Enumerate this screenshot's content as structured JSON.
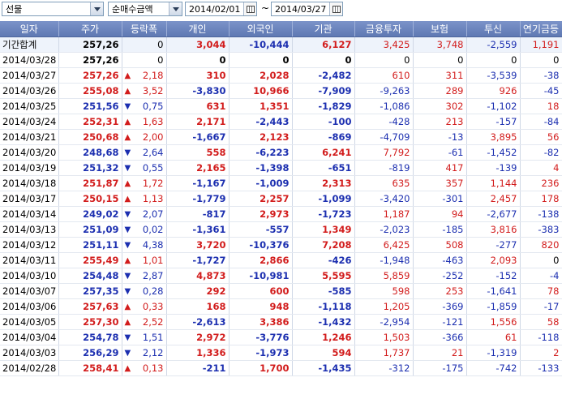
{
  "toolbar": {
    "market_select": "선물",
    "metric_select": "순매수금액",
    "date_from": "2014/02/01",
    "date_sep": "~",
    "date_to": "2014/03/27"
  },
  "columns": [
    "일자",
    "주가",
    "등락폭",
    "개인",
    "외국인",
    "기관",
    "금융투자",
    "보험",
    "투신",
    "연기금등"
  ],
  "rows": [
    {
      "date": "기간합계",
      "price": "257,26",
      "dir": "",
      "chg": "0",
      "ind": "3,044",
      "frgn": "-10,444",
      "inst": "6,127",
      "fin": "3,425",
      "ins": "3,748",
      "trust": "-2,559",
      "pens": "1,191"
    },
    {
      "date": "2014/03/28",
      "price": "257,26",
      "dir": "",
      "chg": "0",
      "ind": "0",
      "frgn": "0",
      "inst": "0",
      "fin": "0",
      "ins": "0",
      "trust": "0",
      "pens": "0"
    },
    {
      "date": "2014/03/27",
      "price": "257,26",
      "dir": "up",
      "chg": "2,18",
      "ind": "310",
      "frgn": "2,028",
      "inst": "-2,482",
      "fin": "610",
      "ins": "311",
      "trust": "-3,539",
      "pens": "-38"
    },
    {
      "date": "2014/03/26",
      "price": "255,08",
      "dir": "up",
      "chg": "3,52",
      "ind": "-3,830",
      "frgn": "10,966",
      "inst": "-7,909",
      "fin": "-9,263",
      "ins": "289",
      "trust": "926",
      "pens": "-45"
    },
    {
      "date": "2014/03/25",
      "price": "251,56",
      "dir": "down",
      "chg": "0,75",
      "ind": "631",
      "frgn": "1,351",
      "inst": "-1,829",
      "fin": "-1,086",
      "ins": "302",
      "trust": "-1,102",
      "pens": "18"
    },
    {
      "date": "2014/03/24",
      "price": "252,31",
      "dir": "up",
      "chg": "1,63",
      "ind": "2,171",
      "frgn": "-2,443",
      "inst": "-100",
      "fin": "-428",
      "ins": "213",
      "trust": "-157",
      "pens": "-84"
    },
    {
      "date": "2014/03/21",
      "price": "250,68",
      "dir": "up",
      "chg": "2,00",
      "ind": "-1,667",
      "frgn": "2,123",
      "inst": "-869",
      "fin": "-4,709",
      "ins": "-13",
      "trust": "3,895",
      "pens": "56"
    },
    {
      "date": "2014/03/20",
      "price": "248,68",
      "dir": "down",
      "chg": "2,64",
      "ind": "558",
      "frgn": "-6,223",
      "inst": "6,241",
      "fin": "7,792",
      "ins": "-61",
      "trust": "-1,452",
      "pens": "-82"
    },
    {
      "date": "2014/03/19",
      "price": "251,32",
      "dir": "down",
      "chg": "0,55",
      "ind": "2,165",
      "frgn": "-1,398",
      "inst": "-651",
      "fin": "-819",
      "ins": "417",
      "trust": "-139",
      "pens": "4"
    },
    {
      "date": "2014/03/18",
      "price": "251,87",
      "dir": "up",
      "chg": "1,72",
      "ind": "-1,167",
      "frgn": "-1,009",
      "inst": "2,313",
      "fin": "635",
      "ins": "357",
      "trust": "1,144",
      "pens": "236"
    },
    {
      "date": "2014/03/17",
      "price": "250,15",
      "dir": "up",
      "chg": "1,13",
      "ind": "-1,779",
      "frgn": "2,257",
      "inst": "-1,099",
      "fin": "-3,420",
      "ins": "-301",
      "trust": "2,457",
      "pens": "178"
    },
    {
      "date": "2014/03/14",
      "price": "249,02",
      "dir": "down",
      "chg": "2,07",
      "ind": "-817",
      "frgn": "2,973",
      "inst": "-1,723",
      "fin": "1,187",
      "ins": "94",
      "trust": "-2,677",
      "pens": "-138"
    },
    {
      "date": "2014/03/13",
      "price": "251,09",
      "dir": "down",
      "chg": "0,02",
      "ind": "-1,361",
      "frgn": "-557",
      "inst": "1,349",
      "fin": "-2,023",
      "ins": "-185",
      "trust": "3,816",
      "pens": "-383"
    },
    {
      "date": "2014/03/12",
      "price": "251,11",
      "dir": "down",
      "chg": "4,38",
      "ind": "3,720",
      "frgn": "-10,376",
      "inst": "7,208",
      "fin": "6,425",
      "ins": "508",
      "trust": "-277",
      "pens": "820"
    },
    {
      "date": "2014/03/11",
      "price": "255,49",
      "dir": "up",
      "chg": "1,01",
      "ind": "-1,727",
      "frgn": "2,866",
      "inst": "-426",
      "fin": "-1,948",
      "ins": "-463",
      "trust": "2,093",
      "pens": "0"
    },
    {
      "date": "2014/03/10",
      "price": "254,48",
      "dir": "down",
      "chg": "2,87",
      "ind": "4,873",
      "frgn": "-10,981",
      "inst": "5,595",
      "fin": "5,859",
      "ins": "-252",
      "trust": "-152",
      "pens": "-4"
    },
    {
      "date": "2014/03/07",
      "price": "257,35",
      "dir": "down",
      "chg": "0,28",
      "ind": "292",
      "frgn": "600",
      "inst": "-585",
      "fin": "598",
      "ins": "253",
      "trust": "-1,641",
      "pens": "78"
    },
    {
      "date": "2014/03/06",
      "price": "257,63",
      "dir": "up",
      "chg": "0,33",
      "ind": "168",
      "frgn": "948",
      "inst": "-1,118",
      "fin": "1,205",
      "ins": "-369",
      "trust": "-1,859",
      "pens": "-17"
    },
    {
      "date": "2014/03/05",
      "price": "257,30",
      "dir": "up",
      "chg": "2,52",
      "ind": "-2,613",
      "frgn": "3,386",
      "inst": "-1,432",
      "fin": "-2,954",
      "ins": "-121",
      "trust": "1,556",
      "pens": "58"
    },
    {
      "date": "2014/03/04",
      "price": "254,78",
      "dir": "down",
      "chg": "1,51",
      "ind": "2,972",
      "frgn": "-3,776",
      "inst": "1,246",
      "fin": "1,503",
      "ins": "-366",
      "trust": "61",
      "pens": "-118"
    },
    {
      "date": "2014/03/03",
      "price": "256,29",
      "dir": "down",
      "chg": "2,12",
      "ind": "1,336",
      "frgn": "-1,973",
      "inst": "594",
      "fin": "1,737",
      "ins": "21",
      "trust": "-1,319",
      "pens": "2"
    },
    {
      "date": "2014/02/28",
      "price": "258,41",
      "dir": "up",
      "chg": "0,13",
      "ind": "-211",
      "frgn": "1,700",
      "inst": "-1,435",
      "fin": "-312",
      "ins": "-175",
      "trust": "-742",
      "pens": "-133"
    }
  ],
  "colors": {
    "up": "#d21c1c",
    "down": "#1c2fb0",
    "header": "#6a83bd"
  },
  "icons": {
    "up": "triangle-up-icon",
    "down": "triangle-down-icon",
    "calendar": "calendar-icon",
    "dropdown": "chevron-down-icon"
  }
}
